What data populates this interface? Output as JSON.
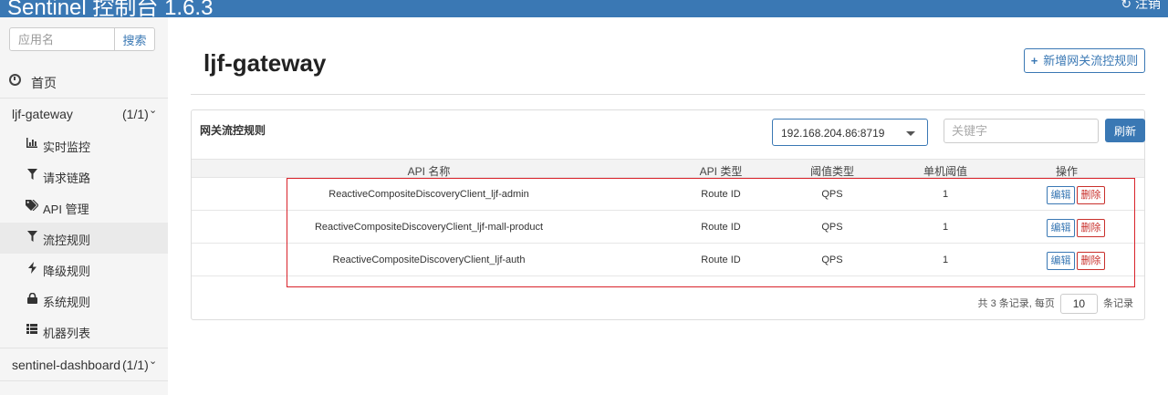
{
  "header": {
    "brand": "Sentinel 控制台 1.6.3",
    "logout_label": "注销"
  },
  "sidebar": {
    "search_placeholder": "应用名",
    "search_button": "搜索",
    "home_label": "首页",
    "apps": [
      {
        "name": "ljf-gateway",
        "count": "(1/1)"
      },
      {
        "name": "sentinel-dashboard",
        "count": "(1/1)"
      }
    ],
    "items": [
      {
        "label": "实时监控",
        "icon": "bar-chart-icon"
      },
      {
        "label": "请求链路",
        "icon": "filter-icon"
      },
      {
        "label": "API 管理",
        "icon": "tags-icon"
      },
      {
        "label": "流控规则",
        "icon": "filter-icon"
      },
      {
        "label": "降级规则",
        "icon": "flash-icon"
      },
      {
        "label": "系统规则",
        "icon": "lock-icon"
      },
      {
        "label": "机器列表",
        "icon": "list-icon"
      }
    ]
  },
  "main": {
    "title": "ljf-gateway",
    "add_button": "新增网关流控规则",
    "panel_title": "网关流控规则",
    "machine_select": "192.168.204.86:8719",
    "keyword_placeholder": "关键字",
    "refresh_button": "刷新",
    "columns": [
      "API 名称",
      "API 类型",
      "阈值类型",
      "单机阈值",
      "操作"
    ],
    "rows": [
      {
        "api": "ReactiveCompositeDiscoveryClient_ljf-admin",
        "type": "Route ID",
        "threshold_type": "QPS",
        "threshold": "1"
      },
      {
        "api": "ReactiveCompositeDiscoveryClient_ljf-mall-product",
        "type": "Route ID",
        "threshold_type": "QPS",
        "threshold": "1"
      },
      {
        "api": "ReactiveCompositeDiscoveryClient_ljf-auth",
        "type": "Route ID",
        "threshold_type": "QPS",
        "threshold": "1"
      }
    ],
    "edit_label": "编辑",
    "delete_label": "删除",
    "pager": {
      "prefix": "共 3 条记录, 每页",
      "page_size": "10",
      "suffix": "条记录"
    }
  },
  "colors": {
    "header_bg": "#3a78b4",
    "primary": "#3a78b4",
    "danger": "#c9302c",
    "highlight_box": "#d9232a"
  }
}
